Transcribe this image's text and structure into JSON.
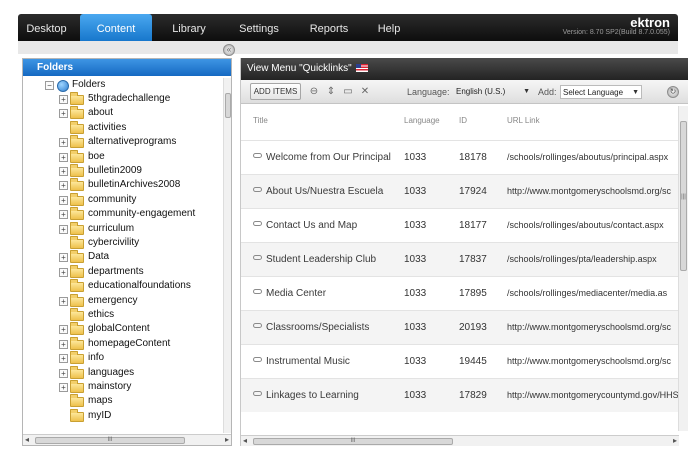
{
  "nav": {
    "tabs": [
      "Desktop",
      "Content",
      "Library",
      "Settings",
      "Reports",
      "Help"
    ],
    "active_tab": "Content",
    "brand": "ektron",
    "version": "Version: 8.70 SP2(Build 8.7.0.055)"
  },
  "folders_panel": {
    "title": "Folders",
    "root": "Folders",
    "items": [
      {
        "label": "5thgradechallenge",
        "expandable": true
      },
      {
        "label": "about",
        "expandable": true
      },
      {
        "label": "activities",
        "expandable": false
      },
      {
        "label": "alternativeprograms",
        "expandable": true
      },
      {
        "label": "boe",
        "expandable": true
      },
      {
        "label": "bulletin2009",
        "expandable": true
      },
      {
        "label": "bulletinArchives2008",
        "expandable": true
      },
      {
        "label": "community",
        "expandable": true
      },
      {
        "label": "community-engagement",
        "expandable": true
      },
      {
        "label": "curriculum",
        "expandable": true
      },
      {
        "label": "cybercivility",
        "expandable": false
      },
      {
        "label": "Data",
        "expandable": true
      },
      {
        "label": "departments",
        "expandable": true
      },
      {
        "label": "educationalfoundations",
        "expandable": false
      },
      {
        "label": "emergency",
        "expandable": true
      },
      {
        "label": "ethics",
        "expandable": false
      },
      {
        "label": "globalContent",
        "expandable": true
      },
      {
        "label": "homepageContent",
        "expandable": true
      },
      {
        "label": "info",
        "expandable": true
      },
      {
        "label": "languages",
        "expandable": true
      },
      {
        "label": "mainstory",
        "expandable": true
      },
      {
        "label": "maps",
        "expandable": false
      },
      {
        "label": "myID",
        "expandable": false
      }
    ],
    "hscroll_label": "III"
  },
  "menu_panel": {
    "title": "View Menu \"Quicklinks\"",
    "add_items_label": "ADD ITEMS",
    "language_label": "Language:",
    "language_value": "English (U.S.)",
    "add_label": "Add:",
    "add_value": "Select Language",
    "columns": [
      "Title",
      "Language",
      "ID",
      "URL Link"
    ],
    "rows": [
      {
        "title": "Welcome from Our Principal",
        "language": "1033",
        "id": "18178",
        "url": "/schools/rollinges/aboutus/principal.aspx"
      },
      {
        "title": "About Us/Nuestra Escuela",
        "language": "1033",
        "id": "17924",
        "url": "http://www.montgomeryschoolsmd.org/sc"
      },
      {
        "title": "Contact Us and Map",
        "language": "1033",
        "id": "18177",
        "url": "/schools/rollinges/aboutus/contact.aspx"
      },
      {
        "title": "Student Leadership Club",
        "language": "1033",
        "id": "17837",
        "url": "/schools/rollinges/pta/leadership.aspx"
      },
      {
        "title": "Media Center",
        "language": "1033",
        "id": "17895",
        "url": "/schools/rollinges/mediacenter/media.as"
      },
      {
        "title": "Classrooms/Specialists",
        "language": "1033",
        "id": "20193",
        "url": "http://www.montgomeryschoolsmd.org/sc"
      },
      {
        "title": "Instrumental Music",
        "language": "1033",
        "id": "19445",
        "url": "http://www.montgomeryschoolsmd.org/sc"
      },
      {
        "title": "Linkages to Learning",
        "language": "1033",
        "id": "17829",
        "url": "http://www.montgomerycountymd.gov/HHS"
      }
    ],
    "hscroll_label": "III",
    "vscroll_label": "|||"
  },
  "colors": {
    "accent": "#1a7bd4",
    "nav_bg": "#161616",
    "header_bg": "#2f2f2f"
  },
  "icons": [
    "collapse-icon",
    "globe-icon",
    "folder-icon",
    "flag-icon",
    "delete-icon",
    "sort-icon",
    "view-icon",
    "remove-icon",
    "refresh-icon",
    "link-icon"
  ]
}
